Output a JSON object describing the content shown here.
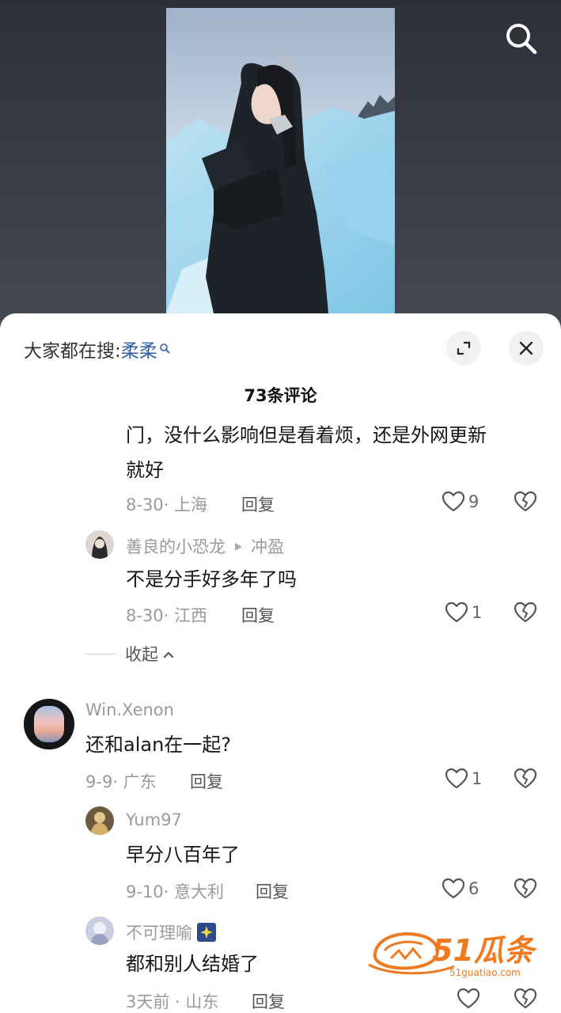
{
  "header": {
    "search_icon": "search-icon"
  },
  "trending": {
    "label": "大家都在搜:",
    "keyword": "柔柔"
  },
  "comments_title": "73条评论",
  "comments": [
    {
      "text_line1": "门，没什么影响但是看着烦，还是外网更新",
      "text_line2": "就好",
      "date": "8-30",
      "location": "上海",
      "reply_label": "回复",
      "likes": "9"
    },
    {
      "author": "善良的小恐龙",
      "reply_to": "冲盈",
      "text": "不是分手好多年了吗",
      "date": "8-30",
      "location": "江西",
      "reply_label": "回复",
      "likes": "1"
    },
    {
      "collapse_label": "收起"
    },
    {
      "author": "Win.Xenon",
      "text": "还和alan在一起?",
      "date": "9-9",
      "location": "广东",
      "reply_label": "回复",
      "likes": "1"
    },
    {
      "author": "Yum97",
      "text": "早分八百年了",
      "date": "9-10",
      "location": "意大利",
      "reply_label": "回复",
      "likes": "6"
    },
    {
      "author": "不可理喻",
      "text": "都和别人结婚了",
      "date": "3天前",
      "location": "山东",
      "reply_label": "回复",
      "likes": ""
    }
  ],
  "watermark": {
    "brand": "51瓜条",
    "site": "51guatiao.com"
  },
  "colors": {
    "keyword": "#2f5fa8",
    "watermark": "#f07a20",
    "meta": "#9a9a9a"
  }
}
